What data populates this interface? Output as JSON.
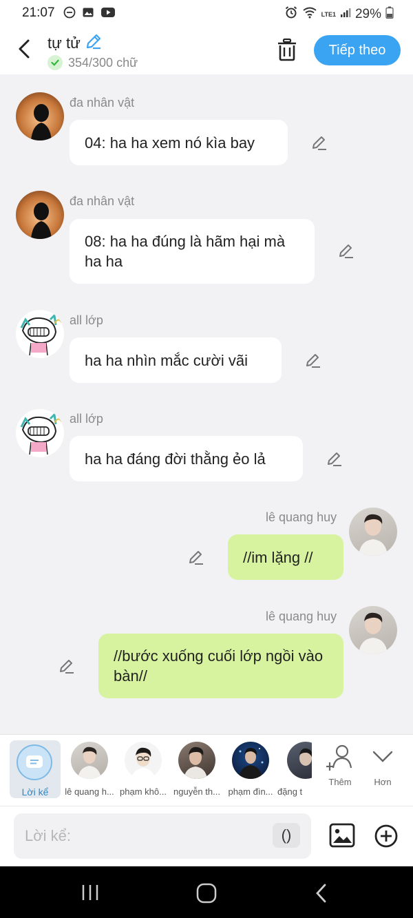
{
  "status": {
    "time": "21:07",
    "battery": "29%",
    "signal_label": "LTE1"
  },
  "header": {
    "title": "tự tử",
    "char_count": "354/300 chữ",
    "next_label": "Tiếp theo"
  },
  "messages": [
    {
      "name": "đa nhân vật",
      "text": "04: ha ha xem nó kìa bay"
    },
    {
      "name": "đa nhân vật",
      "text": "08: ha ha đúng là hãm hại mà ha ha"
    },
    {
      "name": "all lớp",
      "text": "ha ha nhìn mắc cười vãi"
    },
    {
      "name": "all lớp",
      "text": "ha ha đáng đời thằng ẻo lả"
    },
    {
      "name": "lê quang huy",
      "text": "//im lặng //"
    },
    {
      "name": "lê quang huy",
      "text": "//bước xuống cuối lớp ngồi vào bàn//"
    }
  ],
  "characters": {
    "narrator_label": "Lời kể",
    "items": [
      "lê quang h...",
      "phạm khô...",
      "nguyễn th...",
      "phạm đìn...",
      "đặng t"
    ],
    "add_label": "Thêm",
    "more_label": "Hơn"
  },
  "composer": {
    "placeholder": "Lời kể:",
    "paren_label": "()"
  },
  "colors": {
    "accent": "#3aa4f3",
    "self_bubble": "#d7f39f",
    "background": "#f2f2f4"
  }
}
